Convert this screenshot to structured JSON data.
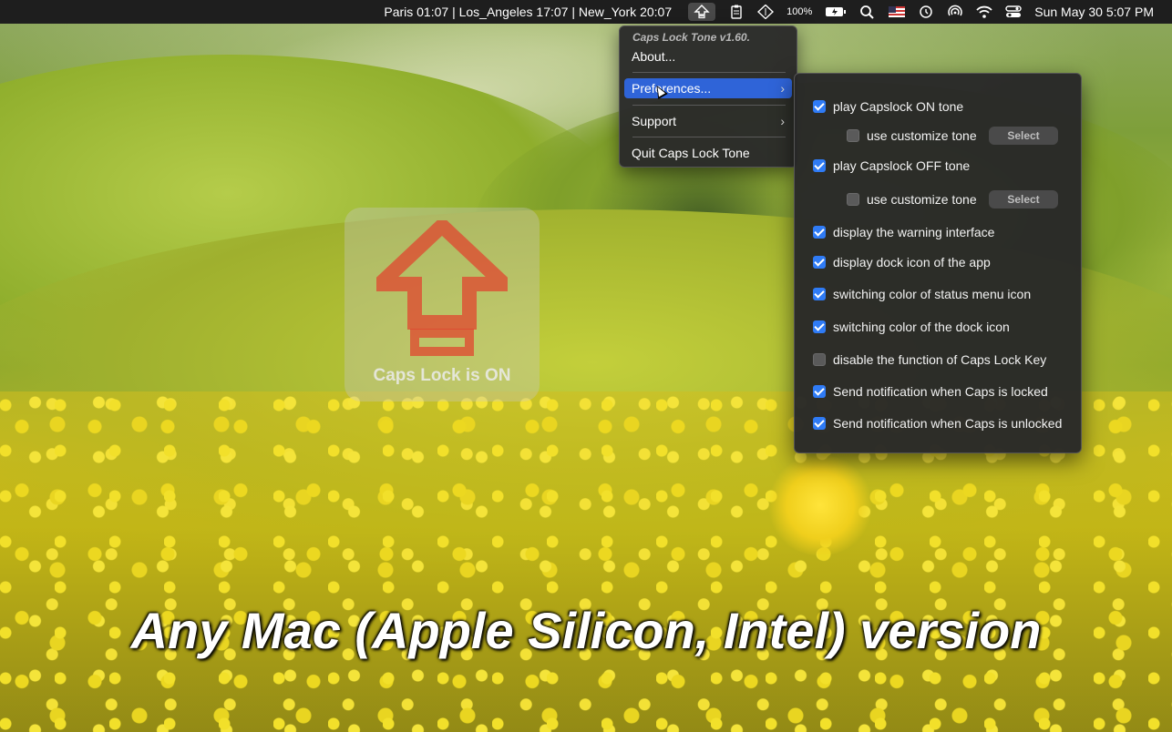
{
  "menubar": {
    "clocks": "Paris 01:07  | Los_Angeles 17:07  | New_York 20:07",
    "zoom": "100%",
    "datetime": "Sun May 30  5:07 PM",
    "icons": [
      "caps-lock-tone-icon",
      "clipboard-icon",
      "diamond-icon",
      "battery-icon",
      "search-icon",
      "us-flag-icon",
      "time-machine-icon",
      "airdrop-icon",
      "wifi-icon",
      "control-center-icon"
    ]
  },
  "menu": {
    "header": "Caps Lock Tone v1.60.",
    "items": [
      {
        "label": "About..."
      },
      {
        "label": "Preferences...",
        "submenu": true
      },
      {
        "label": "Support",
        "submenu": true
      },
      {
        "label": "Quit Caps Lock Tone"
      }
    ]
  },
  "preferences": {
    "select_label": "Select",
    "options": [
      {
        "label": "play Capslock ON tone",
        "checked": true
      },
      {
        "label": "use customize tone",
        "checked": false
      },
      {
        "label": "play Capslock OFF tone",
        "checked": true
      },
      {
        "label": "use customize tone",
        "checked": false
      },
      {
        "label": "display the warning interface",
        "checked": true
      },
      {
        "label": "display dock icon of the app",
        "checked": true
      },
      {
        "label": "switching color of status menu icon",
        "checked": true
      },
      {
        "label": "switching color of the dock icon",
        "checked": true
      },
      {
        "label": "disable the function of Caps Lock Key",
        "checked": false
      },
      {
        "label": "Send notification when Caps is locked",
        "checked": true
      },
      {
        "label": "Send notification when Caps is unlocked",
        "checked": true
      }
    ]
  },
  "hud": {
    "label": "Caps Lock is ON",
    "arrow_color": "#e0452f"
  },
  "caption": "Any Mac (Apple Silicon, Intel) version",
  "colors": {
    "highlight": "#2f64d8",
    "checkbox": "#2f7bf5",
    "menubar": "#1e1e1e"
  }
}
